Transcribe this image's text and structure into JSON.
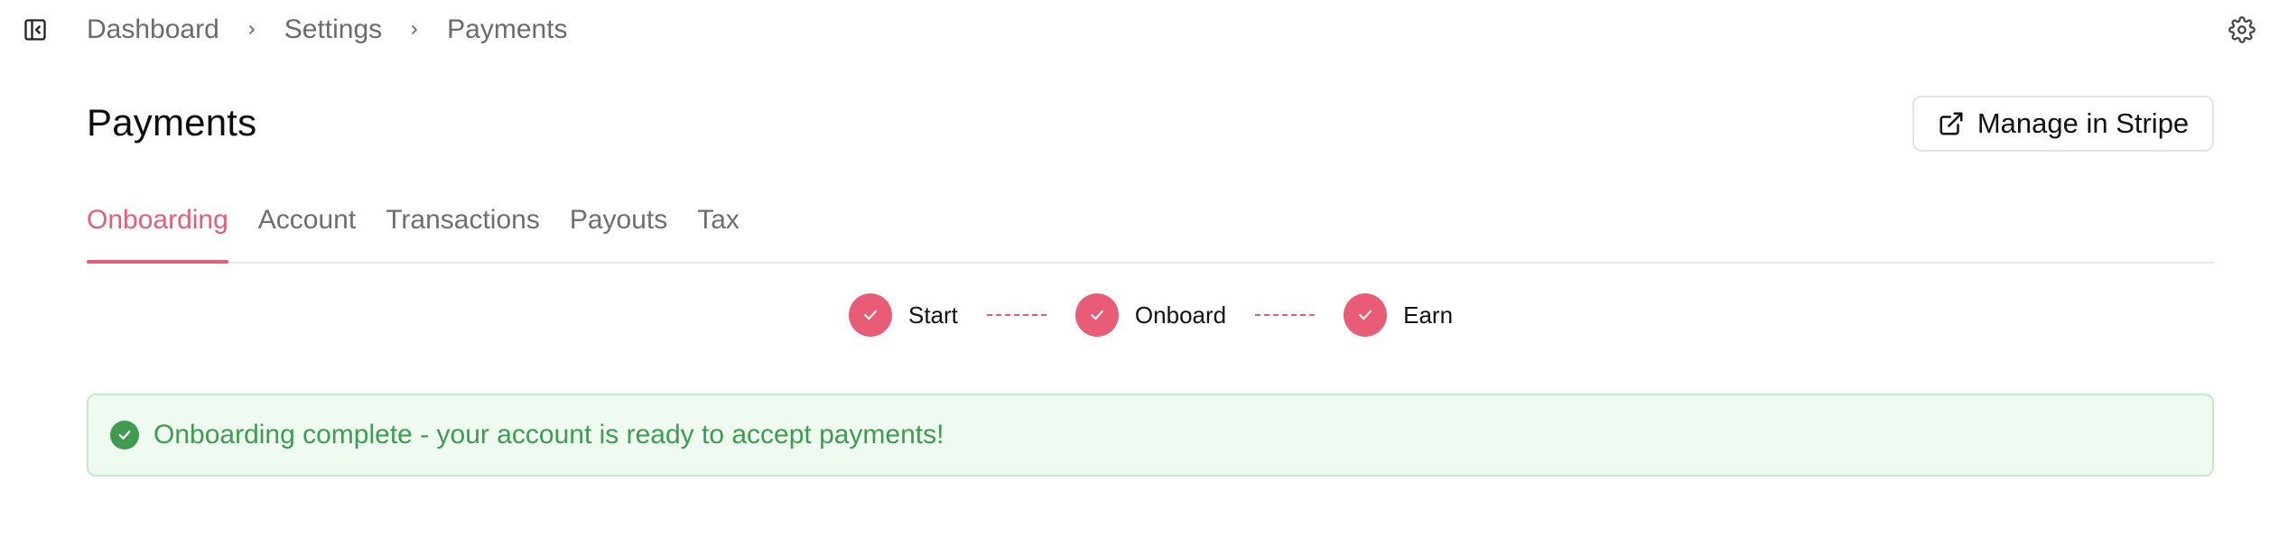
{
  "breadcrumb": {
    "items": [
      "Dashboard",
      "Settings",
      "Payments"
    ]
  },
  "header": {
    "title": "Payments",
    "manage_button_label": "Manage in Stripe"
  },
  "tabs": [
    {
      "label": "Onboarding",
      "active": true
    },
    {
      "label": "Account",
      "active": false
    },
    {
      "label": "Transactions",
      "active": false
    },
    {
      "label": "Payouts",
      "active": false
    },
    {
      "label": "Tax",
      "active": false
    }
  ],
  "stepper": {
    "steps": [
      {
        "label": "Start",
        "complete": true
      },
      {
        "label": "Onboard",
        "complete": true
      },
      {
        "label": "Earn",
        "complete": true
      }
    ]
  },
  "alert": {
    "message": "Onboarding complete - your account is ready to accept payments!",
    "status": "success"
  },
  "icons": {
    "sidebar_toggle": "sidebar-collapse-icon",
    "settings": "gear-icon",
    "external_link": "external-link-icon",
    "step_check": "check-icon",
    "alert": "check-circle-icon"
  },
  "colors": {
    "accent": "#e85d75",
    "success": "#3e9b4f",
    "success_bg": "#effaf0",
    "muted_text": "#6e6e6e"
  }
}
